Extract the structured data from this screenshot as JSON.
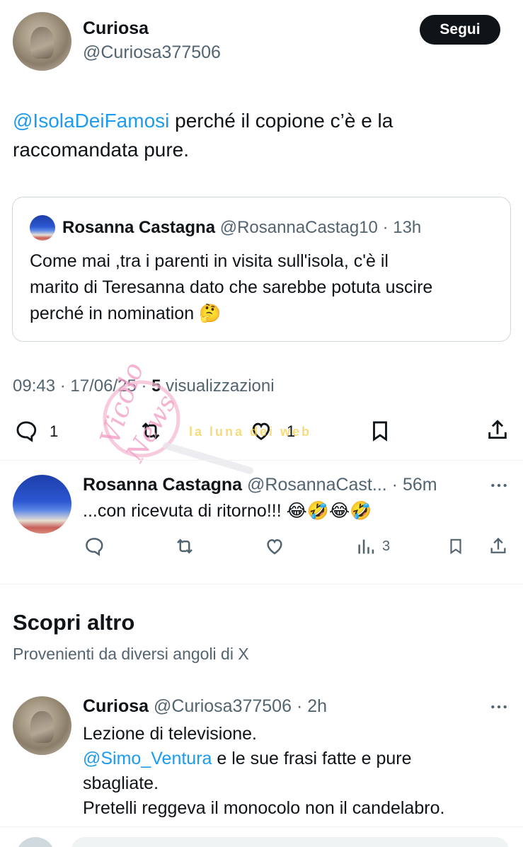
{
  "main_tweet": {
    "author_name": "Curiosa",
    "author_handle": "@Curiosa377506",
    "follow_label": "Segui",
    "text_mention": "@IsolaDeiFamosi",
    "text_line1_rest": " perché il copione c’è e la",
    "text_line2": "raccomandata pure.",
    "timestamp": "09:43 · 17/06/25 · ",
    "views_count": "5",
    "views_label": " visualizzazioni",
    "reply_count": "1",
    "like_count": "1"
  },
  "quoted_tweet": {
    "author_name": "Rosanna Castagna",
    "author_handle": "@RosannaCastag10",
    "time": "· 13h",
    "line1": "Come mai ,tra i parenti in visita sull'isola, c'è il",
    "line2": "marito di Teresanna dato che sarebbe potuta uscire",
    "line3": "perché in nomination 🤔"
  },
  "reply": {
    "author_name": "Rosanna Castagna",
    "author_handle": "@RosannaCast...",
    "time": "· 56m",
    "text": "...con ricevuta di ritorno!!! 😂🤣😂🤣",
    "views_count": "3"
  },
  "discover": {
    "title": "Scopri altro",
    "subtitle": "Provenienti da diversi angoli di X"
  },
  "discover_tweet": {
    "author_name": "Curiosa",
    "author_handle": "@Curiosa377506",
    "time": "· 2h",
    "line1": "Lezione di televisione.",
    "mention": "@Simo_Ventura",
    "line2_rest": " e le sue frasi fatte e pure",
    "line3": "sbagliate.",
    "line4": "Pretelli reggeva il monocolo non il candelabro."
  },
  "watermark": {
    "brand_line1": "Vicolo",
    "brand_line2": "News",
    "tagline": "la luna dei web"
  },
  "colors": {
    "link": "#1d9bf0",
    "text": "#0f1419",
    "secondary": "#536471",
    "border": "#cfd9de",
    "watermark": "#f29ac2"
  }
}
